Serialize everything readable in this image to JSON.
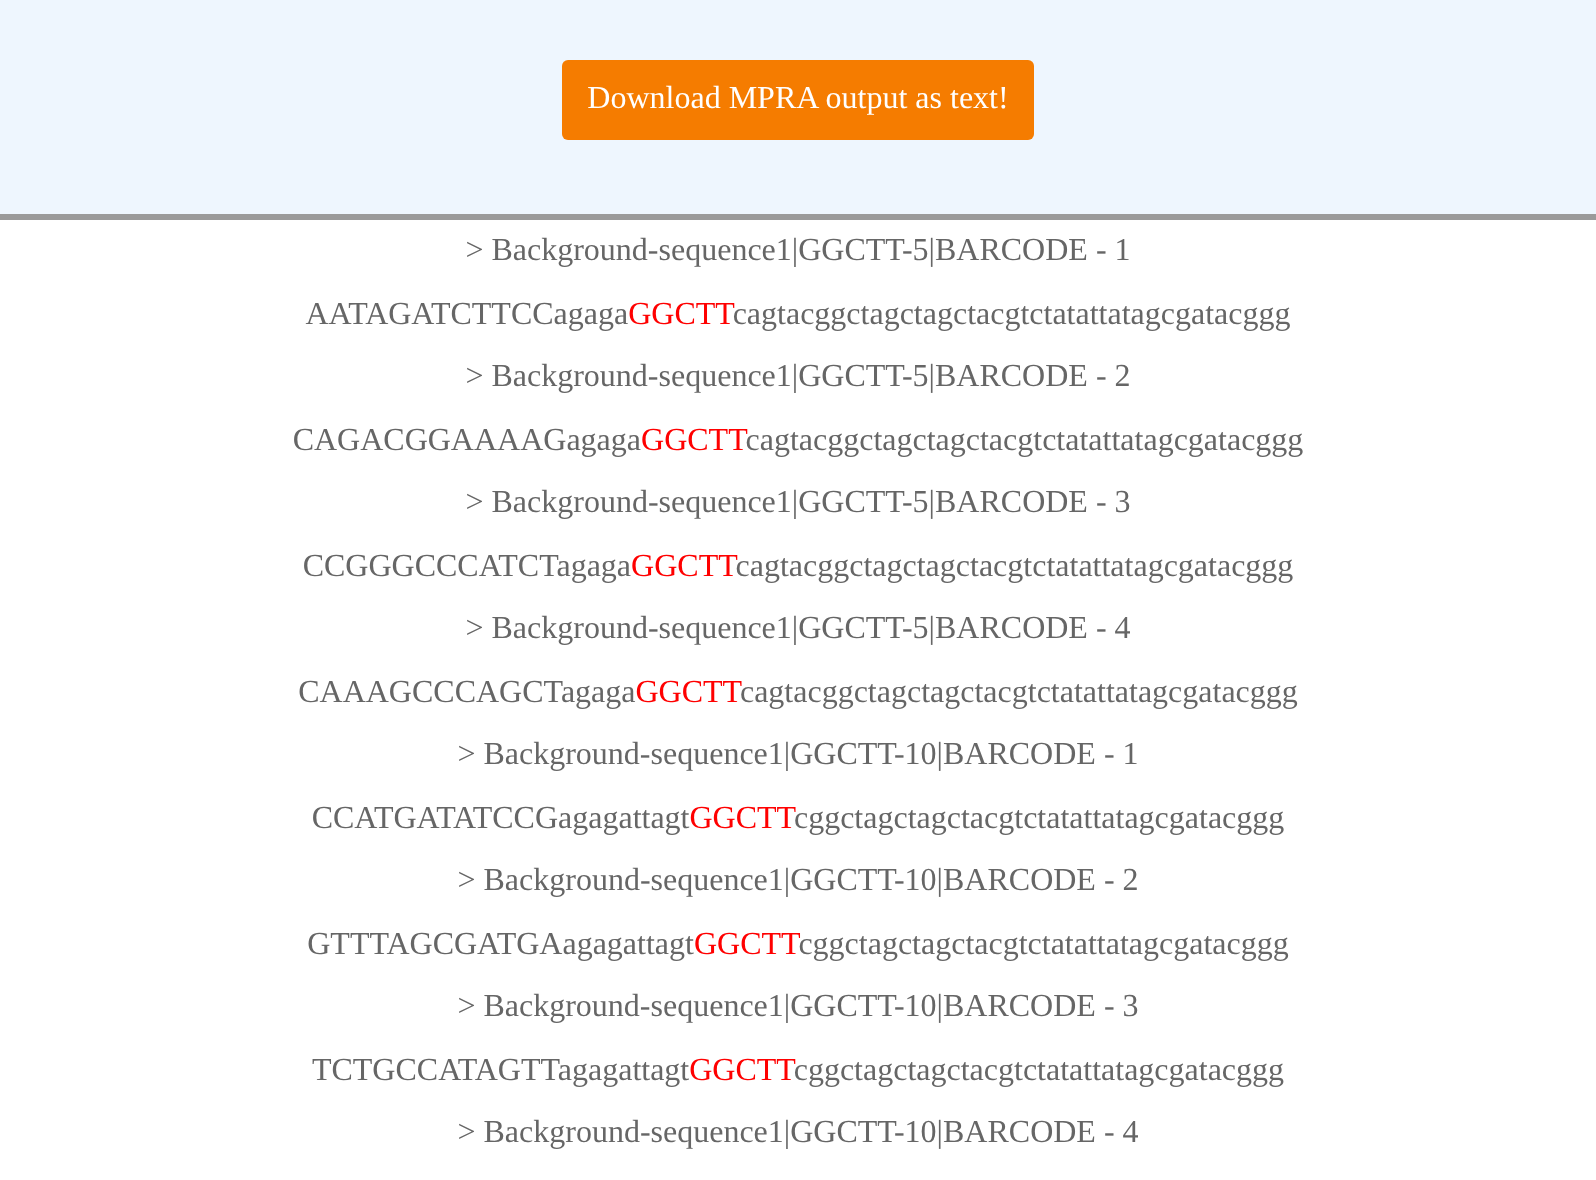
{
  "header": {
    "download_button": "Download MPRA output as text!"
  },
  "records": [
    {
      "heading": "> Background-sequence1|GGCTT-5|BARCODE - 1",
      "sequence": {
        "prefix": "AATAGATCTTCCagaga",
        "motif": "GGCTT",
        "suffix": "cagtacggctagctagctacgtctatattatagcgatacggg"
      }
    },
    {
      "heading": "> Background-sequence1|GGCTT-5|BARCODE - 2",
      "sequence": {
        "prefix": "CAGACGGAAAAGagaga",
        "motif": "GGCTT",
        "suffix": "cagtacggctagctagctacgtctatattatagcgatacggg"
      }
    },
    {
      "heading": "> Background-sequence1|GGCTT-5|BARCODE - 3",
      "sequence": {
        "prefix": "CCGGGCCCATCTagaga",
        "motif": "GGCTT",
        "suffix": "cagtacggctagctagctacgtctatattatagcgatacggg"
      }
    },
    {
      "heading": "> Background-sequence1|GGCTT-5|BARCODE - 4",
      "sequence": {
        "prefix": "CAAAGCCCAGCTagaga",
        "motif": "GGCTT",
        "suffix": "cagtacggctagctagctacgtctatattatagcgatacggg"
      }
    },
    {
      "heading": "> Background-sequence1|GGCTT-10|BARCODE - 1",
      "sequence": {
        "prefix": "CCATGATATCCGagagattagt",
        "motif": "GGCTT",
        "suffix": "cggctagctagctacgtctatattatagcgatacggg"
      }
    },
    {
      "heading": "> Background-sequence1|GGCTT-10|BARCODE - 2",
      "sequence": {
        "prefix": "GTTTAGCGATGAagagattagt",
        "motif": "GGCTT",
        "suffix": "cggctagctagctacgtctatattatagcgatacggg"
      }
    },
    {
      "heading": "> Background-sequence1|GGCTT-10|BARCODE - 3",
      "sequence": {
        "prefix": "TCTGCCATAGTTagagattagt",
        "motif": "GGCTT",
        "suffix": "cggctagctagctacgtctatattatagcgatacggg"
      }
    },
    {
      "heading": "> Background-sequence1|GGCTT-10|BARCODE - 4"
    }
  ]
}
